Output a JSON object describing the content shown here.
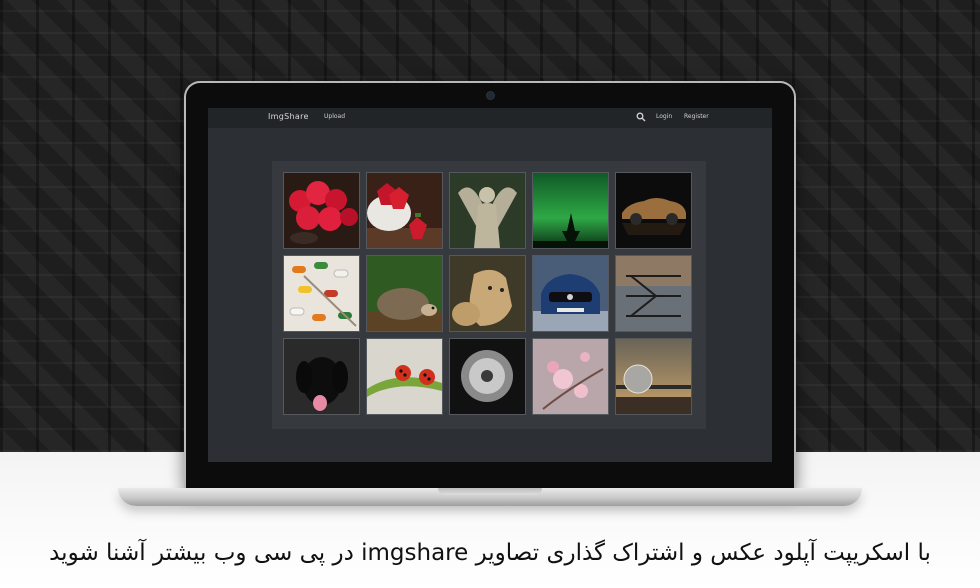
{
  "app": {
    "brand": "ImgShare",
    "nav": {
      "upload": "Upload",
      "login": "Login",
      "register": "Register"
    }
  },
  "gallery": {
    "items": [
      {
        "subject": "raspberries",
        "icon": "raspberries"
      },
      {
        "subject": "strawberries",
        "icon": "strawberries"
      },
      {
        "subject": "angel statue",
        "icon": "statue"
      },
      {
        "subject": "aurora over trees",
        "icon": "aurora"
      },
      {
        "subject": "gold car",
        "icon": "car"
      },
      {
        "subject": "pills",
        "icon": "pills"
      },
      {
        "subject": "hedgehog",
        "icon": "hedgehog"
      },
      {
        "subject": "lioness",
        "icon": "lioness"
      },
      {
        "subject": "mercedes car",
        "icon": "car"
      },
      {
        "subject": "fire escape stairs",
        "icon": "building"
      },
      {
        "subject": "black dog",
        "icon": "dog"
      },
      {
        "subject": "ladybugs",
        "icon": "ladybug"
      },
      {
        "subject": "dandelion",
        "icon": "dandelion"
      },
      {
        "subject": "pink blossoms",
        "icon": "blossom"
      },
      {
        "subject": "glass sphere at pier",
        "icon": "sphere"
      }
    ]
  },
  "caption": "با اسکریپت آپلود عکس و اشتراک گذاری تصاویر imgshare در پی سی وب بیشتر آشنا شوید",
  "colors": {
    "screen_bg": "#2c2f33",
    "navbar_bg": "#222528",
    "gallery_bg": "#36393e"
  }
}
